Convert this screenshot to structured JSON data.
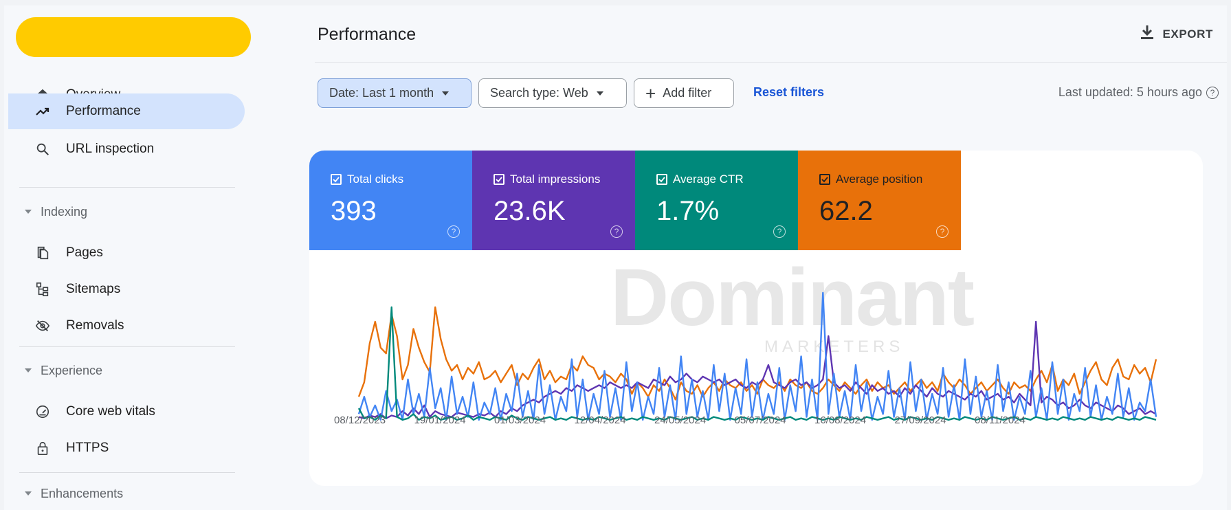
{
  "sidebar": {
    "nav": [
      {
        "label": "Overview",
        "icon": "home-icon"
      },
      {
        "label": "Performance",
        "icon": "trending-up-icon",
        "active": true
      },
      {
        "label": "URL inspection",
        "icon": "search-icon"
      }
    ],
    "indexing": {
      "title": "Indexing",
      "items": [
        {
          "label": "Pages",
          "icon": "pages-icon"
        },
        {
          "label": "Sitemaps",
          "icon": "sitemap-icon"
        },
        {
          "label": "Removals",
          "icon": "eye-off-icon"
        }
      ]
    },
    "experience": {
      "title": "Experience",
      "items": [
        {
          "label": "Core web vitals",
          "icon": "gauge-icon"
        },
        {
          "label": "HTTPS",
          "icon": "lock-icon"
        }
      ]
    },
    "enhancements": {
      "title": "Enhancements"
    }
  },
  "header": {
    "title": "Performance",
    "export_label": "EXPORT"
  },
  "filters": {
    "date": "Date: Last 1 month",
    "search_type": "Search type: Web",
    "add_filter": "Add filter",
    "reset": "Reset filters",
    "last_updated": "Last updated: 5 hours ago"
  },
  "metrics": [
    {
      "label": "Total clicks",
      "value": "393",
      "color": "#4285f4",
      "checked": true
    },
    {
      "label": "Total impressions",
      "value": "23.6K",
      "color": "#5e35b1",
      "checked": true
    },
    {
      "label": "Average CTR",
      "value": "1.7%",
      "color": "#00897b",
      "checked": true
    },
    {
      "label": "Average position",
      "value": "62.2",
      "color": "#e8710a",
      "checked": true
    }
  ],
  "watermark": {
    "word": "Dominant",
    "sub": "MARKETERS"
  },
  "colors": {
    "clicks": "#4285f4",
    "impressions": "#5e35b1",
    "ctr": "#00897b",
    "position": "#e8710a",
    "brand_pill": "#ffcb00",
    "active_nav": "#d3e3fd"
  },
  "chart_data": {
    "type": "line",
    "x_tick_labels": [
      "08/12/2023",
      "19/01/2024",
      "01/03/2024",
      "12/04/2024",
      "24/05/2024",
      "05/07/2024",
      "16/08/2024",
      "27/09/2024",
      "08/11/2024"
    ],
    "grid": false,
    "series": [
      {
        "name": "Average position",
        "color": "#e8710a",
        "values": [
          18,
          28,
          55,
          70,
          52,
          48,
          75,
          60,
          30,
          40,
          65,
          52,
          42,
          35,
          80,
          58,
          44,
          36,
          40,
          30,
          38,
          34,
          42,
          30,
          32,
          36,
          28,
          34,
          40,
          26,
          34,
          30,
          38,
          44,
          30,
          36,
          28,
          32,
          30,
          40,
          36,
          46,
          40,
          38,
          30,
          34,
          32,
          28,
          34,
          30,
          20,
          28,
          24,
          18,
          26,
          22,
          30,
          24,
          16,
          28,
          22,
          20,
          26,
          18,
          24,
          28,
          22,
          30,
          26,
          24,
          28,
          22,
          26,
          20,
          30,
          26,
          24,
          28,
          22,
          30,
          26,
          24,
          28,
          22,
          20,
          24,
          30,
          26,
          22,
          28,
          24,
          20,
          26,
          30,
          22,
          28,
          24,
          26,
          20,
          24,
          28,
          22,
          26,
          30,
          24,
          28,
          22,
          34,
          28,
          24,
          30,
          26,
          20,
          24,
          28,
          22,
          26,
          30,
          24,
          20,
          28,
          24,
          26,
          22,
          30,
          36,
          28,
          40,
          22,
          30,
          26,
          34,
          20,
          28,
          36,
          42,
          30,
          26,
          38,
          44,
          32,
          30,
          40,
          34,
          38,
          28,
          44
        ]
      },
      {
        "name": "Total impressions",
        "color": "#5e35b1",
        "values": [
          4,
          3,
          5,
          4,
          6,
          3,
          5,
          4,
          8,
          5,
          10,
          6,
          12,
          4,
          8,
          6,
          5,
          4,
          7,
          6,
          5,
          4,
          6,
          5,
          7,
          4,
          8,
          6,
          10,
          8,
          12,
          14,
          16,
          14,
          18,
          20,
          22,
          20,
          24,
          22,
          26,
          24,
          22,
          24,
          26,
          24,
          28,
          26,
          24,
          26,
          24,
          28,
          26,
          24,
          30,
          28,
          26,
          32,
          28,
          30,
          34,
          30,
          28,
          32,
          30,
          28,
          30,
          26,
          28,
          30,
          26,
          24,
          28,
          26,
          30,
          40,
          28,
          26,
          24,
          28,
          30,
          26,
          28,
          24,
          26,
          30,
          60,
          28,
          24,
          26,
          22,
          28,
          24,
          20,
          26,
          22,
          24,
          20,
          22,
          18,
          24,
          20,
          26,
          22,
          18,
          24,
          20,
          18,
          22,
          20,
          18,
          16,
          20,
          18,
          22,
          16,
          18,
          20,
          16,
          18,
          14,
          20,
          16,
          12,
          70,
          14,
          18,
          16,
          12,
          14,
          10,
          12,
          16,
          12,
          10,
          14,
          12,
          10,
          8,
          12,
          10,
          6,
          8,
          10,
          6,
          8,
          6
        ]
      },
      {
        "name": "Total clicks",
        "color": "#4285f4",
        "values": [
          6,
          18,
          4,
          12,
          2,
          22,
          8,
          16,
          2,
          30,
          6,
          20,
          4,
          38,
          10,
          24,
          2,
          32,
          6,
          18,
          4,
          28,
          2,
          14,
          6,
          24,
          2,
          20,
          8,
          34,
          4,
          22,
          2,
          40,
          6,
          26,
          2,
          18,
          8,
          44,
          4,
          30,
          2,
          20,
          6,
          36,
          4,
          24,
          2,
          42,
          8,
          28,
          2,
          18,
          6,
          38,
          4,
          26,
          2,
          46,
          6,
          30,
          4,
          22,
          2,
          40,
          8,
          34,
          2,
          24,
          6,
          44,
          4,
          28,
          2,
          20,
          6,
          38,
          2,
          26,
          8,
          46,
          4,
          30,
          2,
          90,
          6,
          34,
          4,
          22,
          2,
          40,
          8,
          28,
          2,
          18,
          6,
          36,
          4,
          24,
          2,
          42,
          8,
          30,
          2,
          20,
          6,
          38,
          4,
          26,
          2,
          44,
          6,
          32,
          4,
          22,
          2,
          40,
          8,
          28,
          2,
          18,
          6,
          36,
          4,
          24,
          2,
          42,
          6,
          30,
          2,
          20,
          8,
          38,
          4,
          26,
          2,
          18,
          6,
          34,
          4,
          24,
          2,
          14,
          8,
          30,
          4
        ]
      },
      {
        "name": "Average CTR",
        "color": "#00897b",
        "values": [
          10,
          3,
          4,
          2,
          5,
          3,
          80,
          4,
          2,
          3,
          6,
          2,
          4,
          3,
          5,
          2,
          3,
          4,
          2,
          3,
          5,
          2,
          4,
          3,
          2,
          4,
          3,
          2,
          5,
          3,
          2,
          4,
          3,
          2,
          3,
          4,
          2,
          3,
          2,
          4,
          3,
          2,
          3,
          2,
          4,
          3,
          2,
          3,
          4,
          2,
          3,
          2,
          4,
          3,
          2,
          3,
          2,
          4,
          3,
          2,
          3,
          4,
          2,
          3,
          2,
          4,
          3,
          2,
          3,
          2,
          4,
          3,
          2,
          3,
          2,
          4,
          3,
          2,
          3,
          4,
          2,
          3,
          2,
          4,
          3,
          2,
          3,
          2,
          4,
          3,
          2,
          3,
          2,
          4,
          3,
          2,
          3,
          4,
          2,
          3,
          2,
          4,
          3,
          2,
          3,
          2,
          4,
          3,
          2,
          3,
          2,
          4,
          3,
          2,
          3,
          2,
          4,
          3,
          2,
          3,
          4,
          2,
          3,
          2,
          4,
          3,
          2,
          3,
          2,
          4,
          3,
          2,
          3,
          2,
          4,
          3,
          2,
          3,
          2,
          4,
          3,
          2,
          3,
          2,
          4,
          3,
          2
        ]
      }
    ]
  }
}
